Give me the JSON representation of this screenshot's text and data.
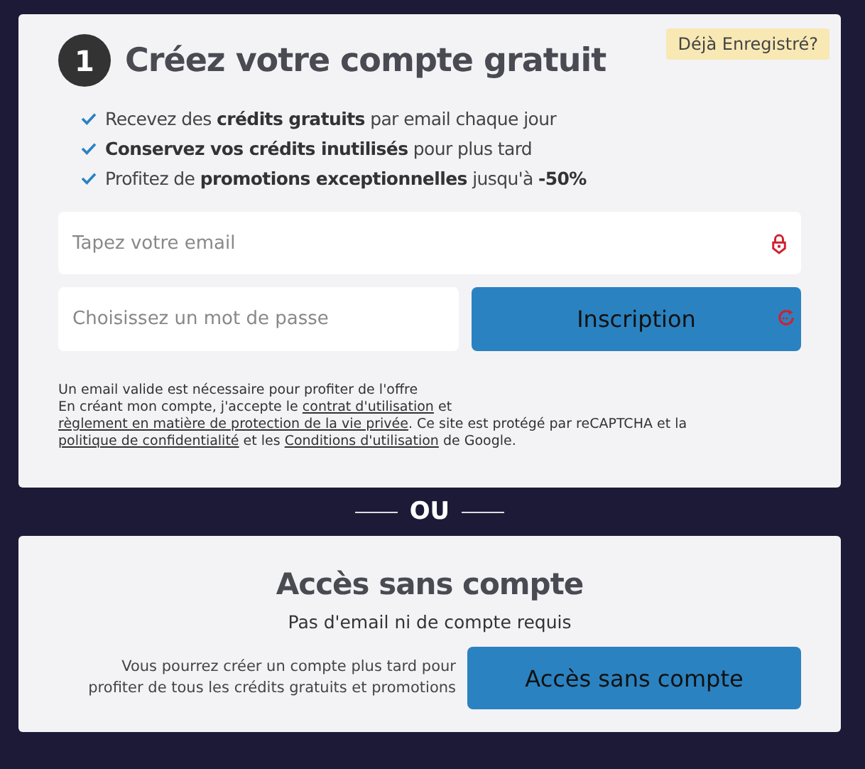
{
  "signup": {
    "step": "1",
    "title": "Créez votre compte gratuit",
    "login_badge": "Déjà Enregistré?",
    "benefits": [
      "Recevez des **crédits gratuits** par email chaque jour",
      "**Conservez vos crédits inutilisés** pour plus tard",
      "Profitez de **promotions exceptionnelles** jusqu'à **-50%**"
    ],
    "email": {
      "placeholder": "Tapez votre email"
    },
    "password": {
      "placeholder": "Choisissez un mot de passe"
    },
    "submit": "Inscription",
    "notice": "Un email valide est nécessaire pour profiter de l'offre",
    "legal": [
      {
        "kind": "text",
        "text": "En créant mon compte, j'accepte le "
      },
      {
        "kind": "link",
        "text": "contrat d'utilisation"
      },
      {
        "kind": "text",
        "text": " et "
      },
      {
        "kind": "link",
        "text": "règlement en matière de protection de la vie privée"
      },
      {
        "kind": "text",
        "text": ". Ce site est protégé par reCAPTCHA et la "
      },
      {
        "kind": "link",
        "text": "politique de confidentialité"
      },
      {
        "kind": "text",
        "text": " et les "
      },
      {
        "kind": "link",
        "text": "Conditions d'utilisation"
      },
      {
        "kind": "text",
        "text": " de Google."
      }
    ]
  },
  "separator": "OU",
  "guest": {
    "title": "Accès sans compte",
    "subtitle": "Pas d'email ni de compte requis",
    "description": "Vous pourrez créer un compte plus tard pour profiter de tous les crédits gratuits et promotions",
    "button": "Accès sans compte"
  }
}
